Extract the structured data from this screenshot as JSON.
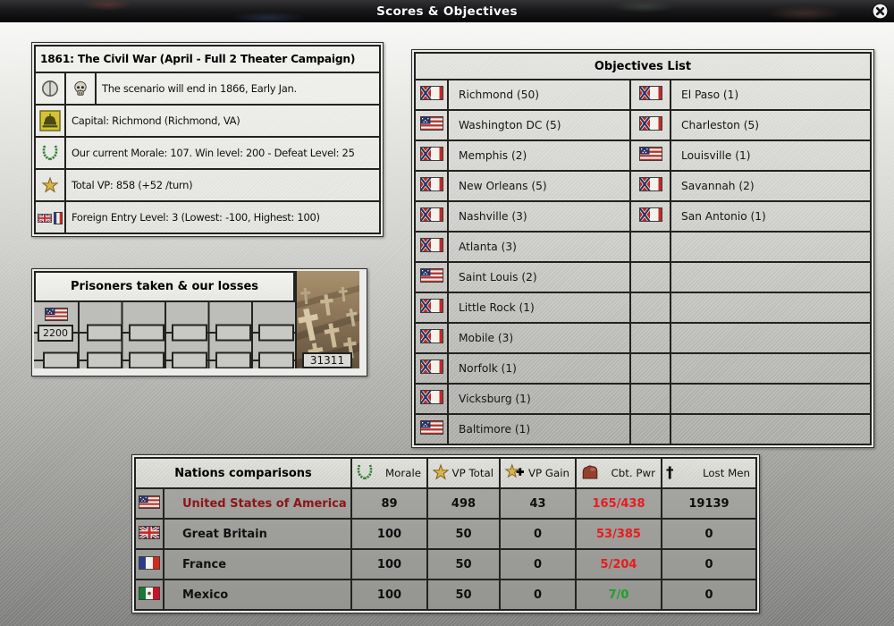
{
  "titlebar": {
    "title": "Scores & Objectives",
    "close_icon": "close-icon"
  },
  "scenario": {
    "title": "1861: The Civil War (April - Full 2 Theater Campaign)",
    "rows": [
      {
        "icons": [
          "clock-icon",
          "skull-icon"
        ],
        "text": "The scenario will end in 1866, Early Jan."
      },
      {
        "icons": [
          "capitol-icon"
        ],
        "text": "Capital: Richmond (Richmond, VA)"
      },
      {
        "icons": [
          "laurel-icon"
        ],
        "text": "Our current Morale: 107. Win level: 200 - Defeat Level: 25"
      },
      {
        "icons": [
          "star-icon"
        ],
        "text": "Total VP: 858 (+52 /turn)"
      },
      {
        "icons": [
          "uk-france-flags-icon"
        ],
        "text": "Foreign Entry Level: 3  (Lowest: -100, Highest: 100)"
      }
    ]
  },
  "prisoners": {
    "title": "Prisoners taken & our losses",
    "flag": "usa",
    "prisoners_value": "2200",
    "losses_value": "31311"
  },
  "objectives": {
    "title": "Objectives List",
    "rows": [
      {
        "left": {
          "flag": "csa",
          "name": "Richmond (50)"
        },
        "right": {
          "flag": "csa",
          "name": "El Paso (1)"
        }
      },
      {
        "left": {
          "flag": "usa",
          "name": "Washington DC (5)"
        },
        "right": {
          "flag": "csa",
          "name": "Charleston (5)"
        }
      },
      {
        "left": {
          "flag": "csa",
          "name": "Memphis (2)"
        },
        "right": {
          "flag": "usa",
          "name": "Louisville (1)"
        }
      },
      {
        "left": {
          "flag": "csa",
          "name": "New Orleans (5)"
        },
        "right": {
          "flag": "csa",
          "name": "Savannah (2)"
        }
      },
      {
        "left": {
          "flag": "csa",
          "name": "Nashville (3)"
        },
        "right": {
          "flag": "csa",
          "name": "San Antonio (1)"
        }
      },
      {
        "left": {
          "flag": "csa",
          "name": "Atlanta (3)"
        },
        "right": null
      },
      {
        "left": {
          "flag": "usa",
          "name": "Saint Louis (2)"
        },
        "right": null
      },
      {
        "left": {
          "flag": "csa",
          "name": "Little Rock (1)"
        },
        "right": null
      },
      {
        "left": {
          "flag": "csa",
          "name": "Mobile (3)"
        },
        "right": null
      },
      {
        "left": {
          "flag": "csa",
          "name": "Norfolk (1)"
        },
        "right": null
      },
      {
        "left": {
          "flag": "csa",
          "name": "Vicksburg (1)"
        },
        "right": null
      },
      {
        "left": {
          "flag": "usa",
          "name": "Baltimore (1)"
        },
        "right": null
      }
    ]
  },
  "nations": {
    "title": "Nations comparisons",
    "columns": [
      {
        "icon": "laurel-icon",
        "label": "Morale"
      },
      {
        "icon": "star-icon",
        "label": "VP Total"
      },
      {
        "icon": "star-plus-icon",
        "label": "VP Gain"
      },
      {
        "icon": "bicep-icon",
        "label": "Cbt. Pwr"
      },
      {
        "icon": "cross-icon",
        "label": "Lost Men"
      }
    ],
    "rows": [
      {
        "flag": "usa",
        "name": "United States of America",
        "name_color": "#8c1616",
        "morale": "89",
        "vp_total": "498",
        "vp_gain": "43",
        "cbt_pwr": "165/438",
        "cbt_pwr_color": "red",
        "lost_men": "19139"
      },
      {
        "flag": "uk",
        "name": "Great Britain",
        "name_color": "#111111",
        "morale": "100",
        "vp_total": "50",
        "vp_gain": "0",
        "cbt_pwr": "53/385",
        "cbt_pwr_color": "red",
        "lost_men": "0"
      },
      {
        "flag": "france",
        "name": "France",
        "name_color": "#111111",
        "morale": "100",
        "vp_total": "50",
        "vp_gain": "0",
        "cbt_pwr": "5/204",
        "cbt_pwr_color": "red",
        "lost_men": "0"
      },
      {
        "flag": "mexico",
        "name": "Mexico",
        "name_color": "#111111",
        "morale": "100",
        "vp_total": "50",
        "vp_gain": "0",
        "cbt_pwr": "7/0",
        "cbt_pwr_color": "green",
        "lost_men": "0"
      }
    ]
  },
  "colors": {
    "combat_loss_red": "#e81c1c",
    "combat_gain_green": "#1fa02a",
    "us_name_red": "#8c1616"
  }
}
